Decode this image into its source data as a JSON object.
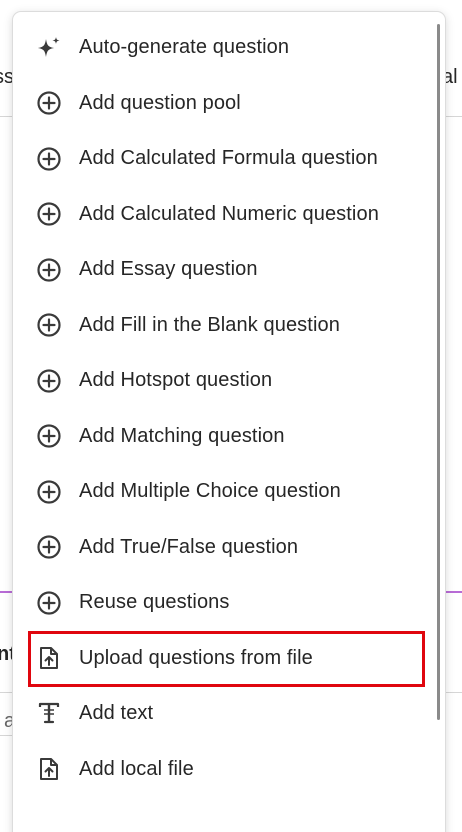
{
  "background": {
    "left_fragment_top": "ssi",
    "right_fragment_top": "al",
    "left_fragment_mid": "nt",
    "left_fragment_low": "a",
    "accent_color": "#b86bd6"
  },
  "menu": {
    "items": [
      {
        "label": "Auto-generate question",
        "icon": "sparkle-icon"
      },
      {
        "label": "Add question pool",
        "icon": "plus-circle-icon"
      },
      {
        "label": "Add Calculated Formula question",
        "icon": "plus-circle-icon"
      },
      {
        "label": "Add Calculated Numeric question",
        "icon": "plus-circle-icon"
      },
      {
        "label": "Add Essay question",
        "icon": "plus-circle-icon"
      },
      {
        "label": "Add Fill in the Blank question",
        "icon": "plus-circle-icon"
      },
      {
        "label": "Add Hotspot question",
        "icon": "plus-circle-icon"
      },
      {
        "label": "Add Matching question",
        "icon": "plus-circle-icon"
      },
      {
        "label": "Add Multiple Choice question",
        "icon": "plus-circle-icon"
      },
      {
        "label": "Add True/False question",
        "icon": "plus-circle-icon"
      },
      {
        "label": "Reuse questions",
        "icon": "plus-circle-icon"
      },
      {
        "label": "Upload questions from file",
        "icon": "upload-file-icon"
      },
      {
        "label": "Add text",
        "icon": "text-icon"
      },
      {
        "label": "Add local file",
        "icon": "upload-file-icon"
      }
    ],
    "highlighted_item": "Upload questions from file",
    "highlight_color": "#e0060e"
  }
}
